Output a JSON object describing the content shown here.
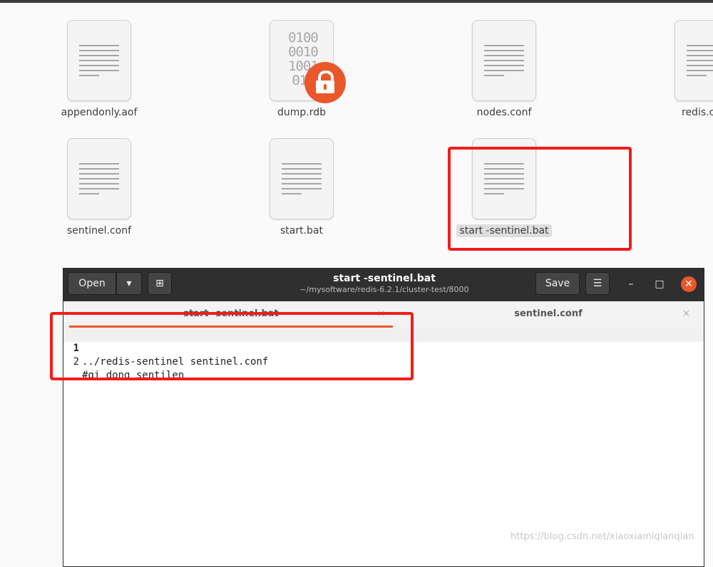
{
  "files": [
    {
      "name": "appendonly.aof",
      "icon": "text-file-icon"
    },
    {
      "name": "dump.rdb",
      "icon": "binary-file-icon",
      "locked": true,
      "binary_text": "0100\n0010\n1001\n011"
    },
    {
      "name": "nodes.conf",
      "icon": "text-file-icon"
    },
    {
      "name": "redis.c",
      "icon": "text-file-icon"
    },
    {
      "name": "sentinel.conf",
      "icon": "text-file-icon"
    },
    {
      "name": "start.bat",
      "icon": "text-file-icon"
    },
    {
      "name": "start -sentinel.bat",
      "icon": "text-file-icon",
      "selected": true
    }
  ],
  "editor": {
    "open_label": "Open",
    "save_label": "Save",
    "title": "start -sentinel.bat",
    "subtitle": "~/mysoftware/redis-6.2.1/cluster-test/8000",
    "tabs": [
      {
        "label": "start -sentinel.bat",
        "active": true
      },
      {
        "label": "sentinel.conf",
        "active": false
      }
    ],
    "lines": [
      {
        "number": "1",
        "text": "../redis-sentinel sentinel.conf"
      },
      {
        "number": "2",
        "text": "#qi dong sentilen"
      }
    ]
  },
  "watermark": "https://blog.csdn.net/xiaoxiamiqianqian",
  "colors": {
    "accent": "#e9572a",
    "highlight_box": "#f21c1c",
    "header": "#2f2f2f"
  }
}
